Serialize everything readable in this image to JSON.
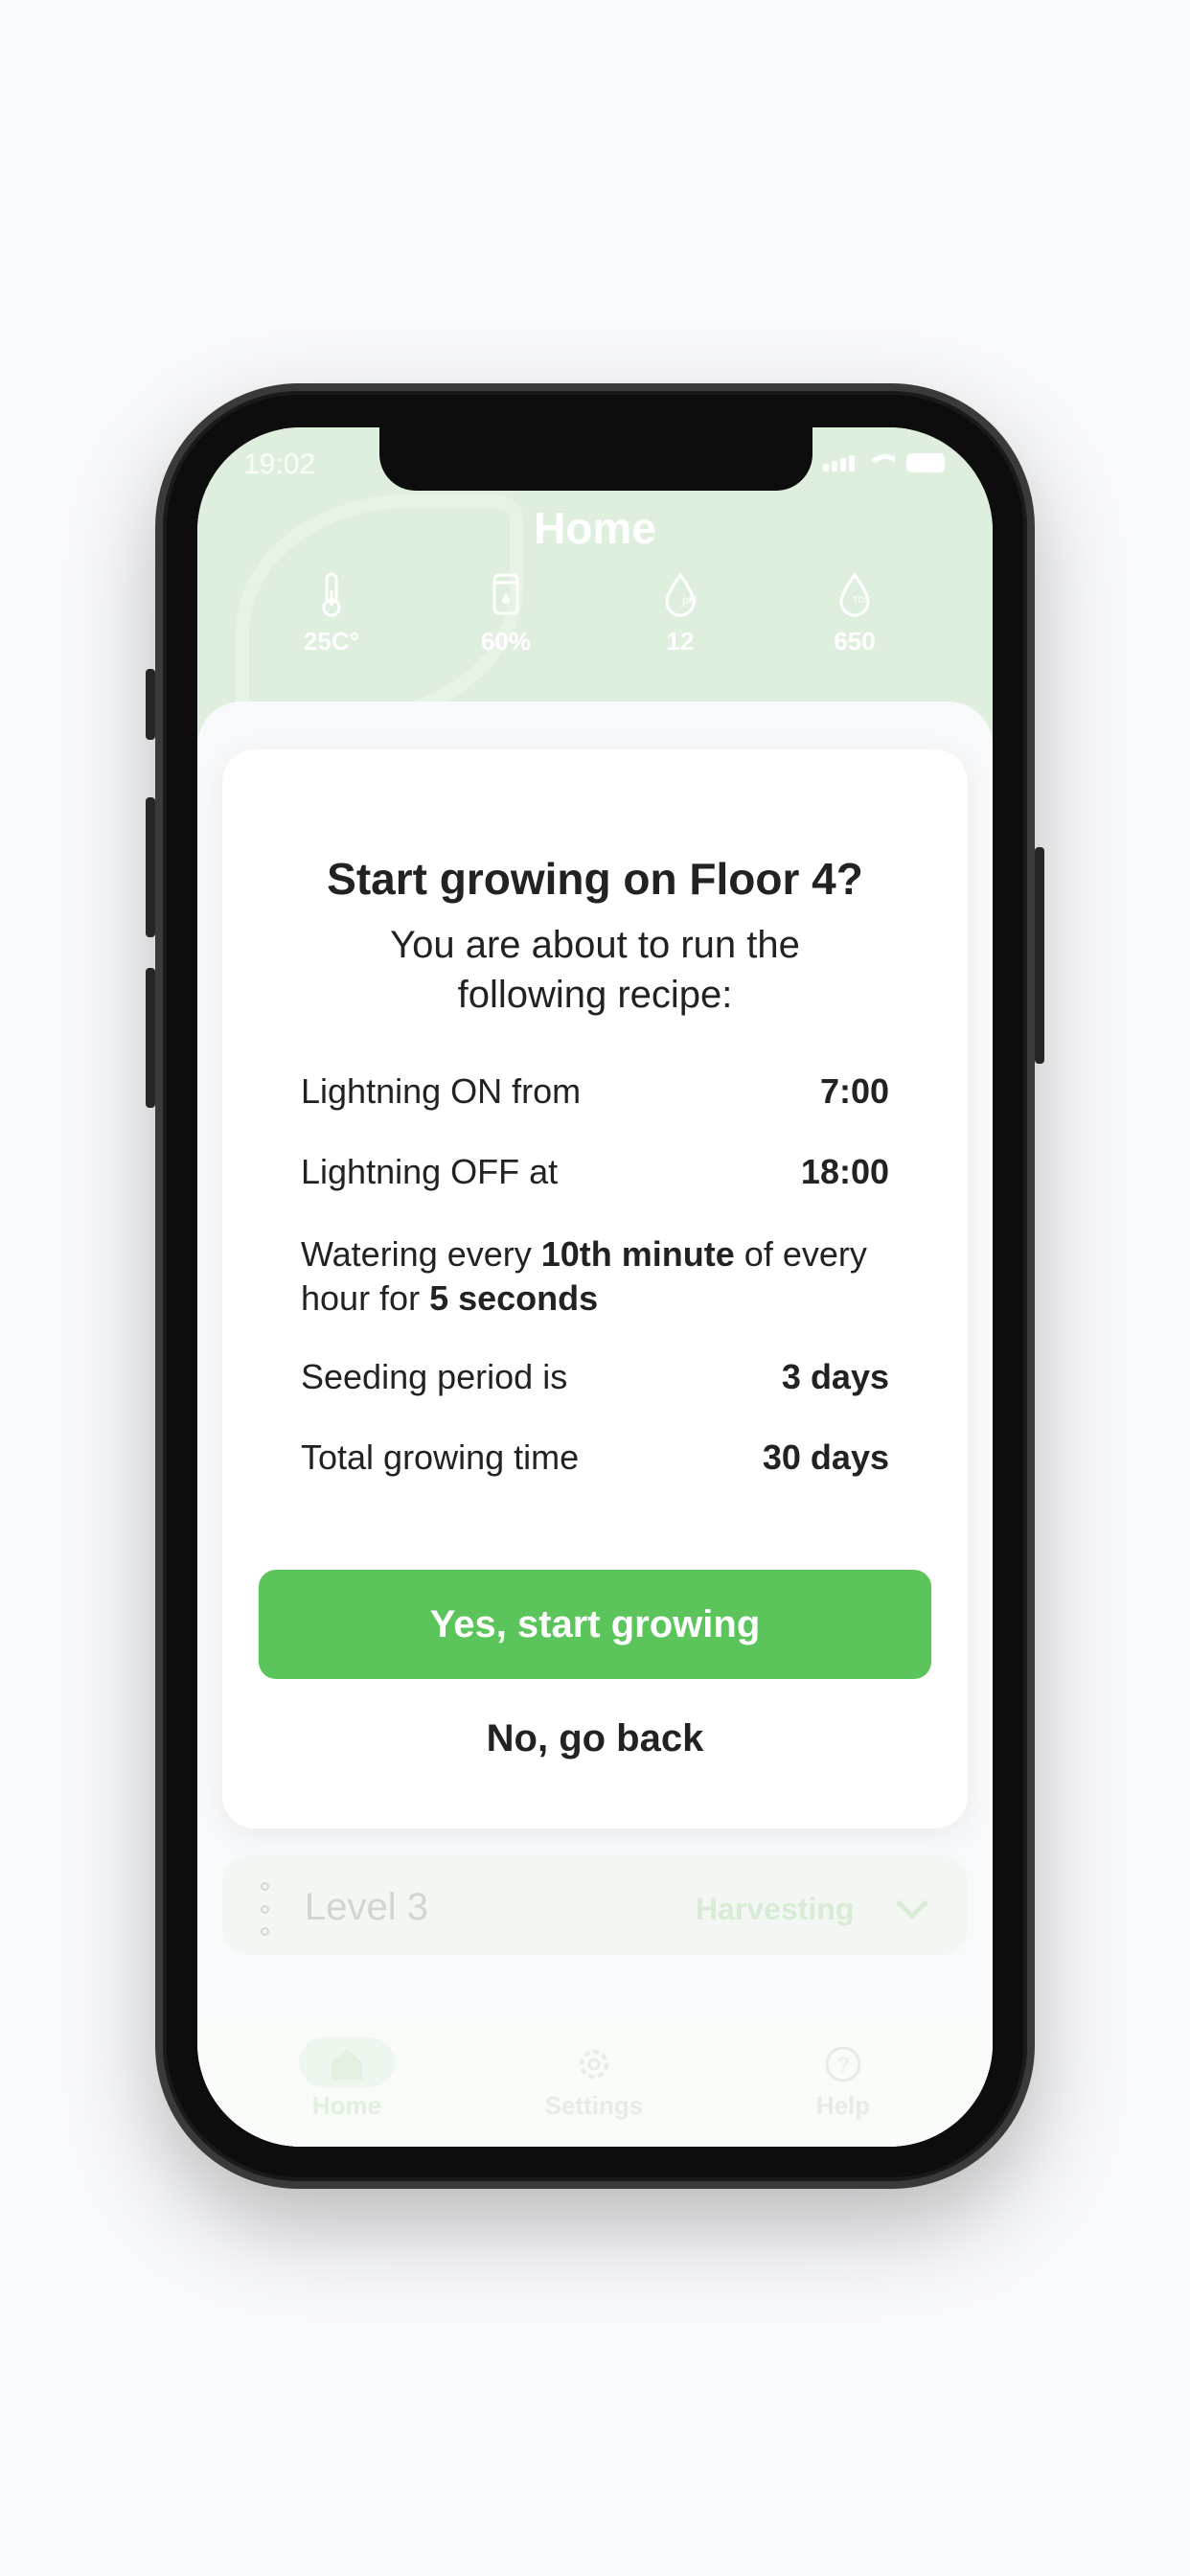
{
  "status_bar": {
    "time": "19:02"
  },
  "header": {
    "title": "Home",
    "sensors": [
      {
        "icon": "thermometer-icon",
        "value": "25C°"
      },
      {
        "icon": "water-tank-icon",
        "value": "60%"
      },
      {
        "icon": "ph-drop-icon",
        "icon_text": "pH",
        "value": "12"
      },
      {
        "icon": "tds-drop-icon",
        "icon_text": "TDS",
        "value": "650"
      }
    ]
  },
  "modal": {
    "title": "Start growing on Floor 4?",
    "subtitle": "You are about to run the following recipe:",
    "rows": [
      {
        "label": "Lightning ON from",
        "value": "7:00"
      },
      {
        "label": "Lightning OFF at",
        "value": "18:00"
      },
      {
        "label": "Seeding period is",
        "value": "3 days"
      },
      {
        "label": "Total growing time",
        "value": "30 days"
      }
    ],
    "watering": {
      "part1": "Watering every ",
      "bold1": "10th minute",
      "part2": " of every hour for ",
      "bold2": "5 seconds"
    },
    "confirm_label": "Yes, start growing",
    "cancel_label": "No, go back",
    "accent_color": "#5bc55b"
  },
  "level_row": {
    "label": "Level 3",
    "status": "Harvesting"
  },
  "tabbar": {
    "tabs": [
      {
        "label": "Home",
        "icon": "home-icon",
        "active": true
      },
      {
        "label": "Settings",
        "icon": "gear-icon",
        "active": false
      },
      {
        "label": "Help",
        "icon": "help-icon",
        "active": false
      }
    ]
  }
}
